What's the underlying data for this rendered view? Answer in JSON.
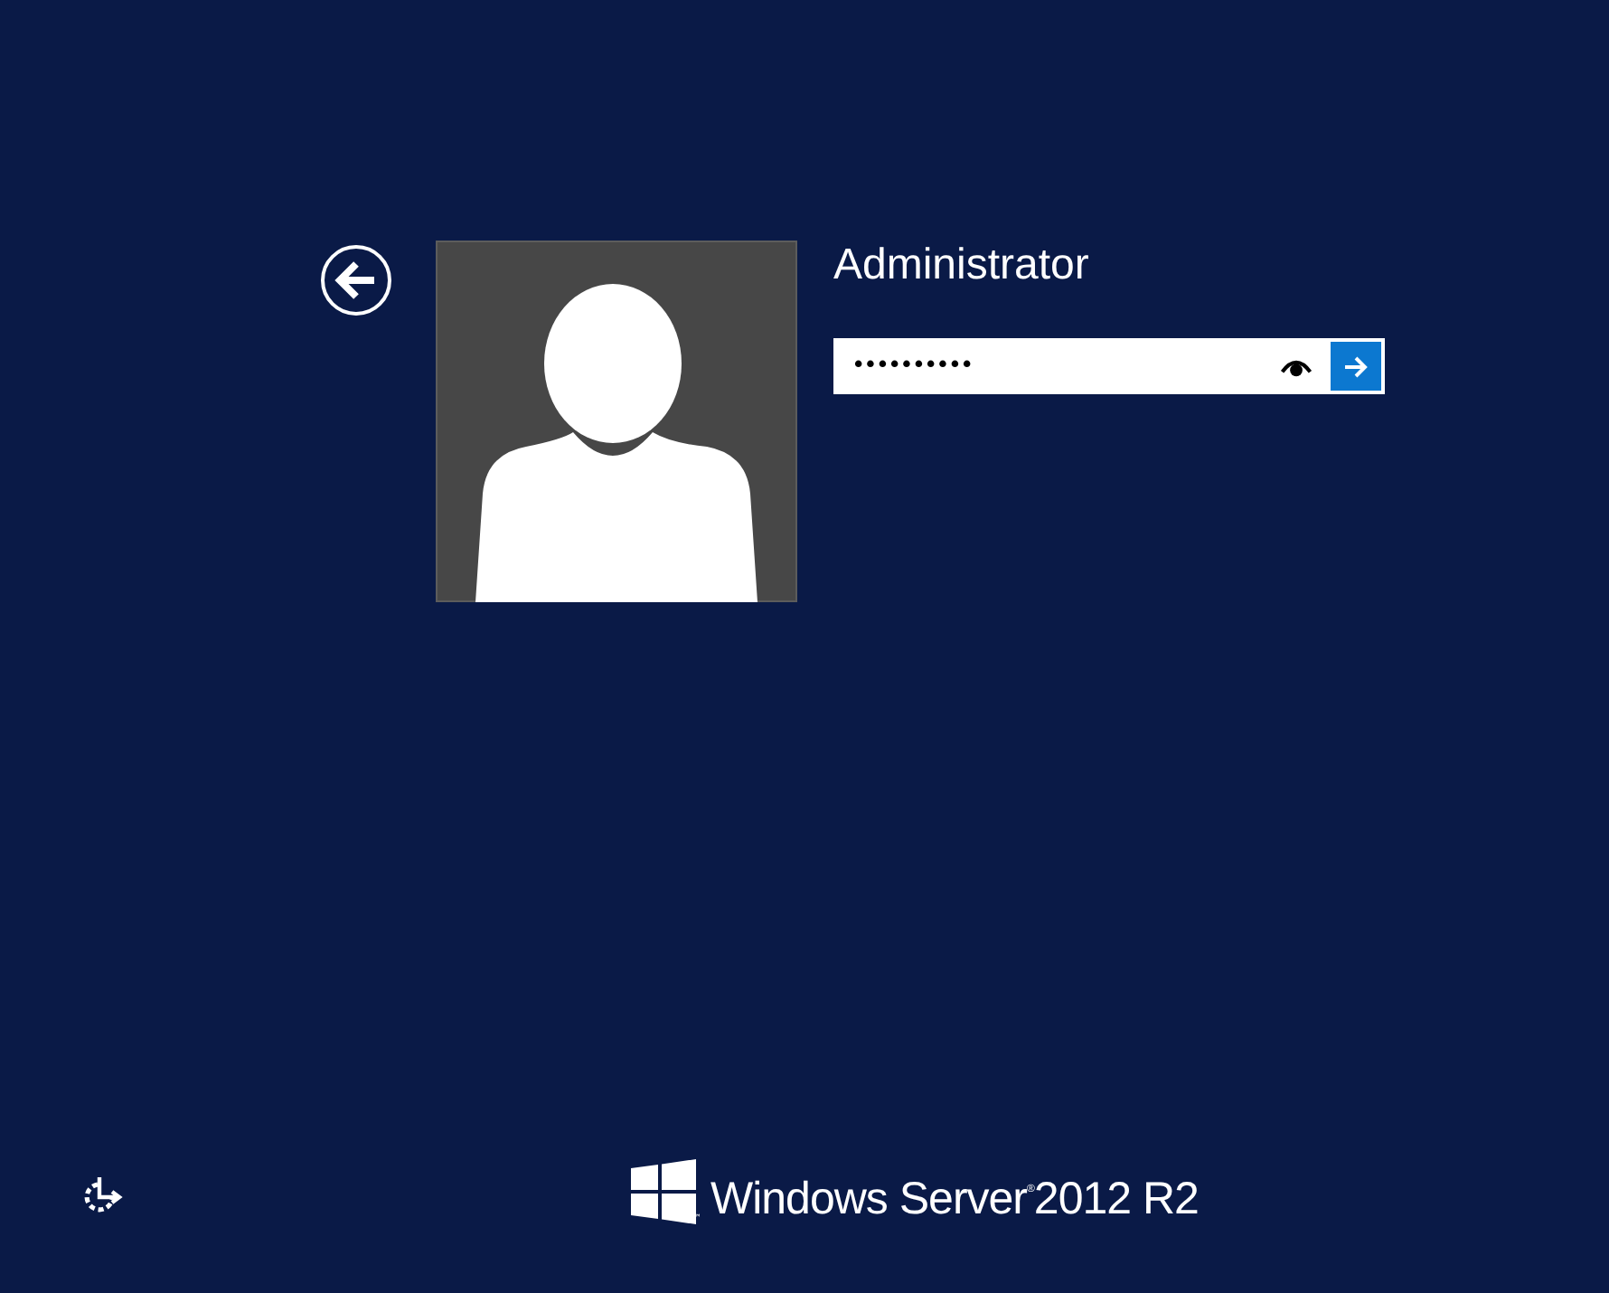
{
  "user": {
    "name": "Administrator"
  },
  "password": {
    "value": "••••••••••",
    "revealed": false
  },
  "branding": {
    "product": "Windows Server$^{®}$2012 R2",
    "trademark": "™"
  }
}
